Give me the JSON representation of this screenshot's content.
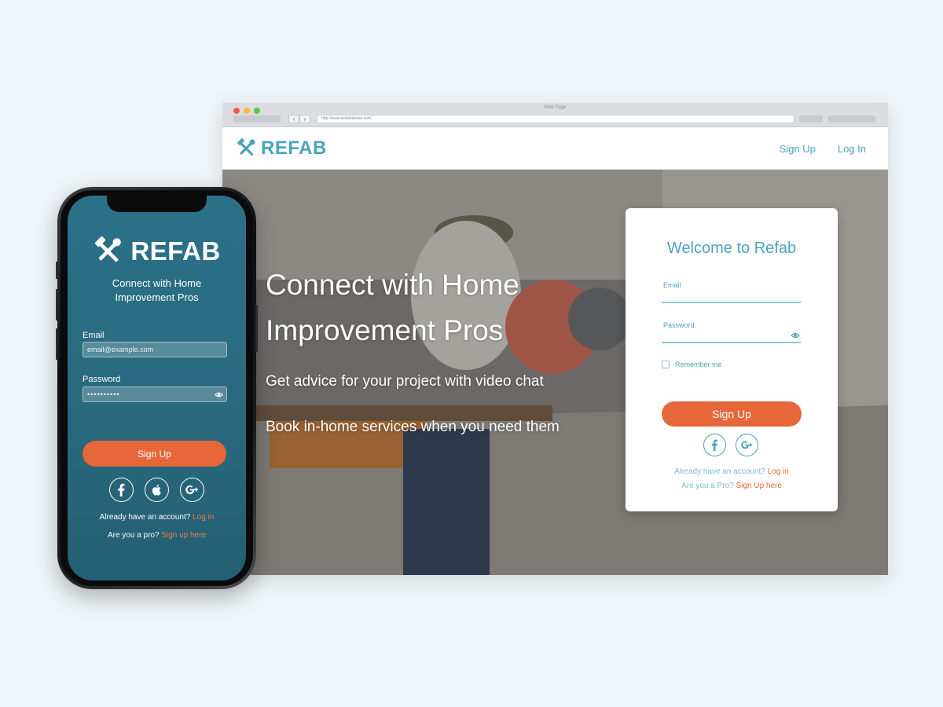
{
  "colors": {
    "brand_teal": "#4ba3bf",
    "accent_orange": "#e5673a",
    "phone_bg": "#2a6a7f",
    "page_bg": "#eef4f7"
  },
  "browser": {
    "window_title": "Web Page",
    "url": "http://www.websitebase.com",
    "back_icon": "chevron-left-icon",
    "forward_icon": "chevron-right-icon"
  },
  "site": {
    "logo_icon": "hammer-wrench-icon",
    "logo_text": "REFAB",
    "nav": {
      "signup": "Sign Up",
      "login": "Log In"
    },
    "hero": {
      "title": "Connect with Home Improvement Pros",
      "subtitle_1": "Get advice for your project with video chat",
      "subtitle_2": "Book in-home services when you need them"
    },
    "card": {
      "title": "Welcome to Refab",
      "email_label": "Email",
      "password_label": "Password",
      "remember_label": "Remember me",
      "signup_button": "Sign Up",
      "socials": [
        "facebook-icon",
        "google-plus-icon"
      ],
      "have_account": "Already have an account?",
      "login_link": "Log in",
      "are_you_pro": "Are you a Pro?",
      "pro_link": "Sign Up here"
    }
  },
  "phone": {
    "logo_icon": "hammer-wrench-icon",
    "logo_text": "REFAB",
    "tagline": "Connect with Home Improvement Pros",
    "email_label": "Email",
    "email_placeholder": "email@example.com",
    "password_label": "Password",
    "password_value": "••••••••••",
    "signup_button": "Sign Up",
    "socials": [
      "facebook-icon",
      "apple-icon",
      "google-plus-icon"
    ],
    "have_account": "Already have an account?",
    "login_link": "Log in",
    "are_you_pro": "Are you a pro?",
    "pro_link": "Sign up here"
  }
}
